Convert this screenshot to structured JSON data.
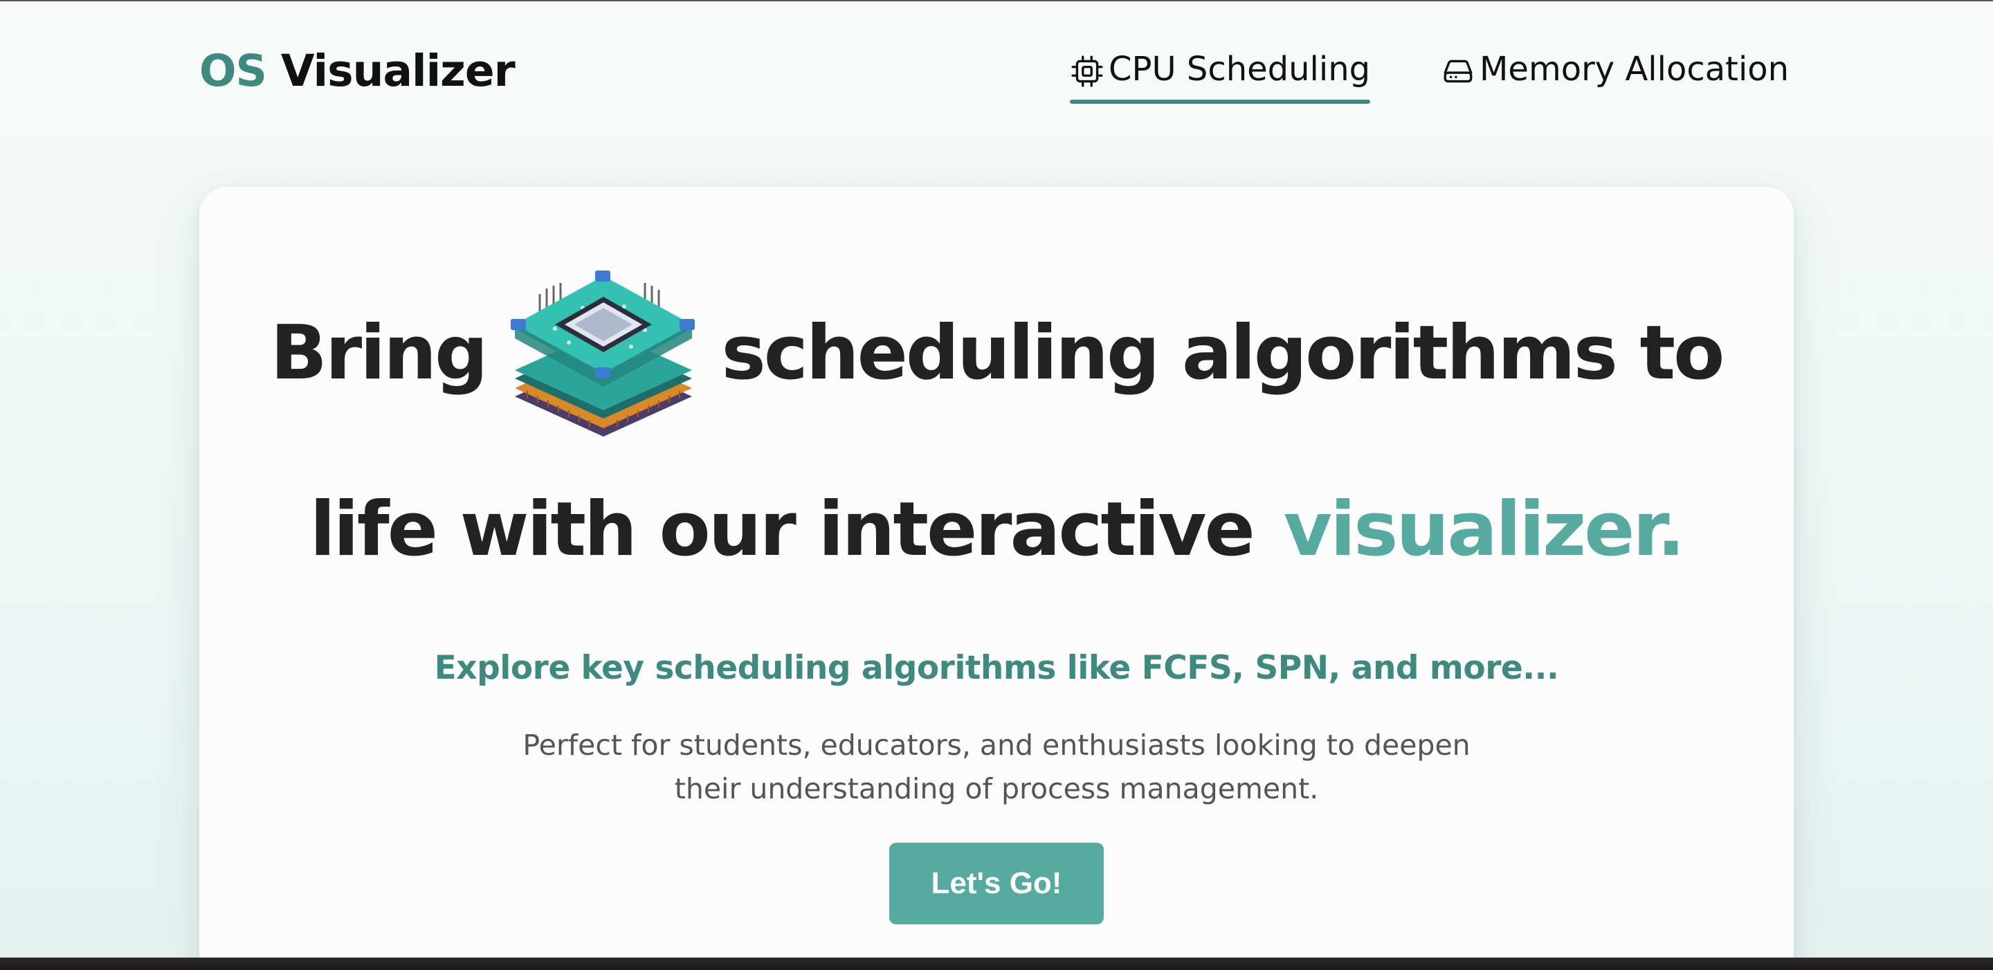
{
  "logo": {
    "prefix": "OS",
    "name": "Visualizer"
  },
  "nav": {
    "items": [
      {
        "label": "CPU Scheduling",
        "icon": "cpu-icon",
        "active": true
      },
      {
        "label": "Memory Allocation",
        "icon": "hard-drive-icon",
        "active": false
      }
    ]
  },
  "hero": {
    "line1_start": "Bring",
    "line1_end": "scheduling algorithms to",
    "line2_start": "life with our interactive",
    "line2_accent": "visualizer.",
    "image_icon": "processor-chip-illustration",
    "subtitle": "Explore key scheduling algorithms like FCFS, SPN, and more...",
    "description": "Perfect for students, educators, and enthusiasts looking to deepen their understanding of process management.",
    "cta_label": "Let's Go!"
  },
  "colors": {
    "accent": "#56aaa0",
    "accent_dark": "#3f8a80",
    "heading": "#222222",
    "body_text": "#555555"
  }
}
